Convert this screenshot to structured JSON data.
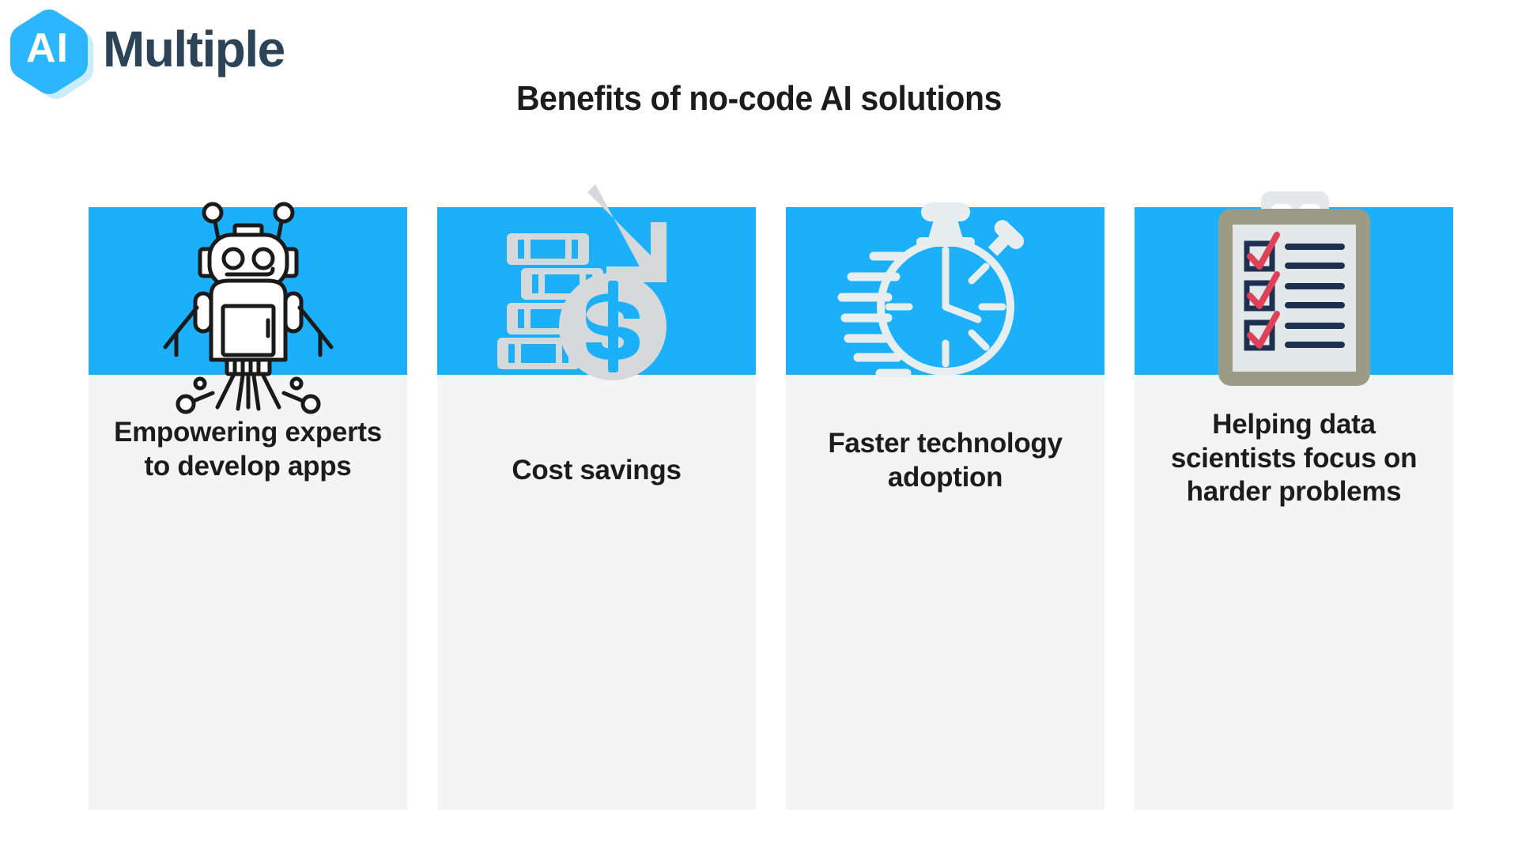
{
  "brand": {
    "mark_text": "AI",
    "word": "Multiple",
    "hex_blue": "#1cb0fb",
    "hex_navy": "#2c4358"
  },
  "header": {
    "title": "Benefits of no-code AI solutions"
  },
  "theme": {
    "card_header_blue": "#1cb0fb",
    "card_body_gray": "#f4f4f4",
    "text_dark": "#1c1c1c",
    "icon_light": "#d6d9da",
    "icon_white": "#ffffff",
    "icon_outline": "#1a1a1a",
    "clipboard_board": "#9c9b85",
    "clipboard_paper": "#e3e9ea",
    "clipboard_line_navy": "#1e3050",
    "clipboard_check_red": "#e0415a"
  },
  "cards": [
    {
      "icon": "robot-icon",
      "label": "Empowering experts to develop apps"
    },
    {
      "icon": "money-savings-icon",
      "label": "Cost savings"
    },
    {
      "icon": "stopwatch-icon",
      "label": "Faster technology adoption"
    },
    {
      "icon": "clipboard-checklist-icon",
      "label": "Helping data scientists focus on harder problems"
    }
  ]
}
